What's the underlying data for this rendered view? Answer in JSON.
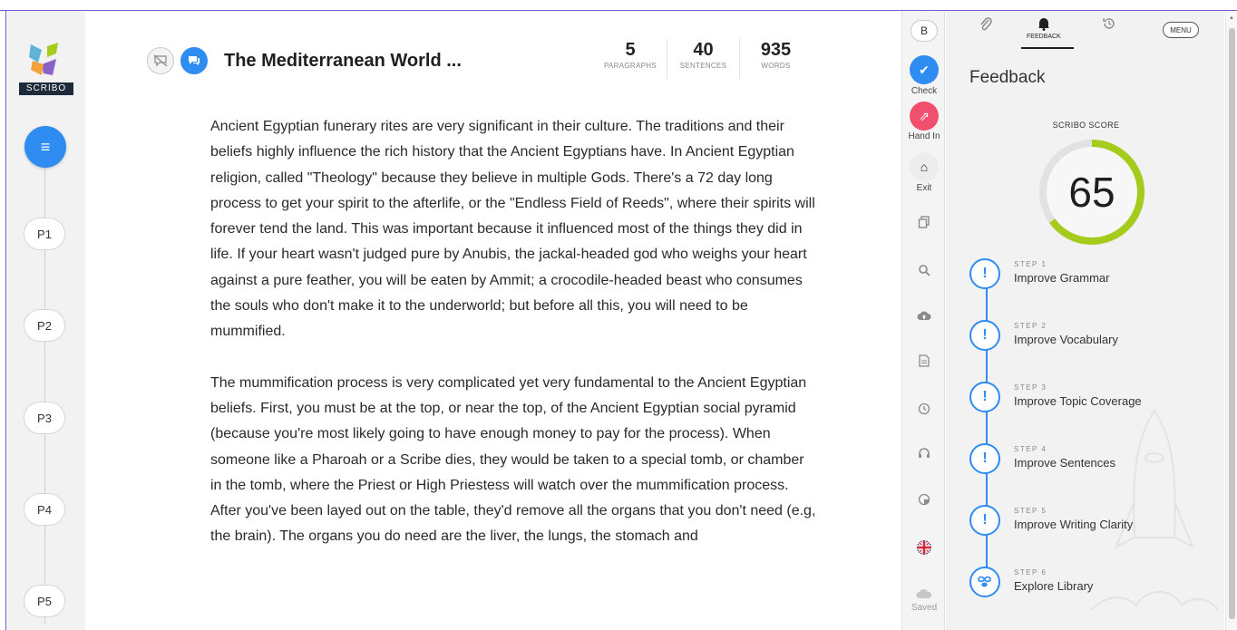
{
  "app": {
    "logo_text": "SCRIBO"
  },
  "nav": {
    "paragraph_buttons": [
      "P1",
      "P2",
      "P3",
      "P4",
      "P5"
    ]
  },
  "document": {
    "title": "The Mediterranean World ...",
    "stats": [
      {
        "value": "5",
        "label": "PARAGRAPHS"
      },
      {
        "value": "40",
        "label": "SENTENCES"
      },
      {
        "value": "935",
        "label": "WORDS"
      }
    ],
    "paragraphs": [
      "Ancient Egyptian funerary rites are very significant in their culture. The traditions and their beliefs highly influence the rich history that the Ancient Egyptians have. In Ancient Egyptian religion, called \"Theology\" because they believe in multiple Gods. There's a 72 day long process to get your spirit to the afterlife, or the \"Endless Field of Reeds\", where their spirits will forever tend the land. This was important because it influenced most of the things they did in life. If your heart wasn't judged pure by Anubis, the jackal-headed god who weighs your heart against a pure feather, you will be eaten by Ammit; a crocodile-headed beast who consumes the souls who don't make it to the underworld; but before all this, you will need to be mummified.",
      "The mummification process is very complicated yet very fundamental to the Ancient Egyptian beliefs. First, you must be at the top, or near the top, of the Ancient Egyptian social pyramid (because you're most likely going to have enough money to pay for the process). When someone like a Pharoah or a Scribe dies, they would be taken to a special tomb, or chamber in the tomb, where the Priest or High Priestess will watch over the mummification process. After you've been layed out on the table, they'd remove all the organs that you don't need (e.g, the brain). The organs you do need are the liver, the lungs, the stomach and"
    ]
  },
  "tools": {
    "b_label": "B",
    "check_label": "Check",
    "hand_in_label": "Hand In",
    "exit_label": "Exit",
    "saved_label": "Saved"
  },
  "panel": {
    "tab_feedback": "FEEDBACK",
    "menu_label": "MENU",
    "title": "Feedback",
    "score_label": "SCRIBO SCORE",
    "score_value": "65",
    "score_fraction": 0.65,
    "steps": [
      {
        "num": "STEP 1",
        "label": "Improve Grammar",
        "icon": "exclamation-icon"
      },
      {
        "num": "STEP 2",
        "label": "Improve Vocabulary",
        "icon": "exclamation-icon"
      },
      {
        "num": "STEP 3",
        "label": "Improve Topic Coverage",
        "icon": "exclamation-icon"
      },
      {
        "num": "STEP 4",
        "label": "Improve Sentences",
        "icon": "exclamation-icon"
      },
      {
        "num": "STEP 5",
        "label": "Improve Writing Clarity",
        "icon": "exclamation-icon"
      },
      {
        "num": "STEP 6",
        "label": "Explore Library",
        "icon": "library-icon"
      }
    ]
  },
  "colors": {
    "accent": "#2f8cf0",
    "hand_in": "#f0506e",
    "score_ring": "#a5cc1d"
  }
}
